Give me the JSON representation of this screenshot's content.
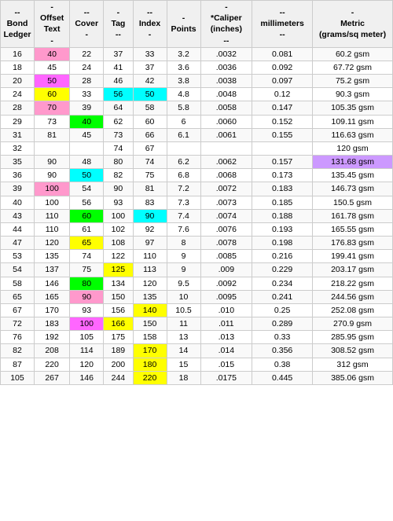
{
  "headers": [
    {
      "label": "--\nBond\nLedger",
      "sub": ""
    },
    {
      "label": "-\nOffset\nText",
      "sub": "-"
    },
    {
      "label": "--\nCover",
      "sub": "-"
    },
    {
      "label": "-\nTag",
      "sub": "--"
    },
    {
      "label": "--\nIndex",
      "sub": "-"
    },
    {
      "label": "-\nPoints",
      "sub": ""
    },
    {
      "label": "-\n*Caliper\n(inches)",
      "sub": "--"
    },
    {
      "label": "--\nmillimeters",
      "sub": "--"
    },
    {
      "label": "-\nMetric\n(grams/sq meter)",
      "sub": ""
    }
  ],
  "rows": [
    {
      "bond": 16,
      "offset": "40",
      "cover": 22,
      "tag": 37,
      "index": 33,
      "points": 3.2,
      "caliper": ".0032",
      "mm": "0.081",
      "metric": "60.2 gsm",
      "colors": {
        "offset": "pink"
      }
    },
    {
      "bond": 18,
      "offset": "45",
      "cover": 24,
      "tag": 41,
      "index": 37,
      "points": 3.6,
      "caliper": ".0036",
      "mm": "0.092",
      "metric": "67.72 gsm",
      "colors": {}
    },
    {
      "bond": 20,
      "offset": "50",
      "cover": 28,
      "tag": 46,
      "index": 42,
      "points": 3.8,
      "caliper": ".0038",
      "mm": "0.097",
      "metric": "75.2 gsm",
      "colors": {
        "offset": "magenta"
      }
    },
    {
      "bond": 24,
      "offset": "60",
      "cover": 33,
      "tag": 56,
      "index": 50,
      "points": 4.8,
      "caliper": ".0048",
      "mm": "0.12",
      "metric": "90.3 gsm",
      "colors": {
        "offset": "yellow",
        "tag": "cyan",
        "index": "cyan"
      }
    },
    {
      "bond": 28,
      "offset": "70",
      "cover": 39,
      "tag": 64,
      "index": 58,
      "points": 5.8,
      "caliper": ".0058",
      "mm": "0.147",
      "metric": "105.35 gsm",
      "colors": {
        "offset": "pink"
      }
    },
    {
      "bond": 29,
      "offset": "73",
      "cover": "40",
      "tag": 62,
      "index": 60,
      "points": 6,
      "caliper": ".0060",
      "mm": "0.152",
      "metric": "109.11 gsm",
      "colors": {
        "cover": "green"
      }
    },
    {
      "bond": 31,
      "offset": "81",
      "cover": 45,
      "tag": 73,
      "index": 66,
      "points": 6.1,
      "caliper": ".0061",
      "mm": "0.155",
      "metric": "116.63 gsm",
      "colors": {}
    },
    {
      "bond": 32,
      "offset": "",
      "cover": "",
      "tag": 74,
      "index": 67,
      "points": "",
      "caliper": "",
      "mm": "",
      "metric": "120 gsm",
      "colors": {}
    },
    {
      "bond": 35,
      "offset": "90",
      "cover": 48,
      "tag": 80,
      "index": 74,
      "points": 6.2,
      "caliper": ".0062",
      "mm": "0.157",
      "metric": "131.68 gsm",
      "colors": {
        "metric": "lavender"
      }
    },
    {
      "bond": 36,
      "offset": "90",
      "cover": "50",
      "tag": 82,
      "index": 75,
      "points": 6.8,
      "caliper": ".0068",
      "mm": "0.173",
      "metric": "135.45 gsm",
      "colors": {
        "cover": "cyan"
      }
    },
    {
      "bond": 39,
      "offset": "100",
      "cover": 54,
      "tag": 90,
      "index": 81,
      "points": 7.2,
      "caliper": ".0072",
      "mm": "0.183",
      "metric": "146.73 gsm",
      "colors": {
        "offset": "pink"
      }
    },
    {
      "bond": 40,
      "offset": "100",
      "cover": 56,
      "tag": 93,
      "index": 83,
      "points": 7.3,
      "caliper": ".0073",
      "mm": "0.185",
      "metric": "150.5 gsm",
      "colors": {}
    },
    {
      "bond": 43,
      "offset": "110",
      "cover": "60",
      "tag": 100,
      "index": "90",
      "points": 7.4,
      "caliper": ".0074",
      "mm": "0.188",
      "metric": "161.78 gsm",
      "colors": {
        "cover": "green",
        "index": "cyan"
      }
    },
    {
      "bond": 44,
      "offset": "110",
      "cover": 61,
      "tag": 102,
      "index": 92,
      "points": 7.6,
      "caliper": ".0076",
      "mm": "0.193",
      "metric": "165.55 gsm",
      "colors": {}
    },
    {
      "bond": 47,
      "offset": "120",
      "cover": "65",
      "tag": 108,
      "index": 97,
      "points": 8,
      "caliper": ".0078",
      "mm": "0.198",
      "metric": "176.83 gsm",
      "colors": {
        "cover": "yellow"
      }
    },
    {
      "bond": 53,
      "offset": "135",
      "cover": 74,
      "tag": 122,
      "index": 110,
      "points": 9,
      "caliper": ".0085",
      "mm": "0.216",
      "metric": "199.41 gsm",
      "colors": {}
    },
    {
      "bond": 54,
      "offset": "137",
      "cover": 75,
      "tag": "125",
      "index": 113,
      "points": 9,
      "caliper": ".009",
      "mm": "0.229",
      "metric": "203.17 gsm",
      "colors": {
        "tag": "yellow"
      }
    },
    {
      "bond": 58,
      "offset": "146",
      "cover": "80",
      "tag": 134,
      "index": 120,
      "points": 9.5,
      "caliper": ".0092",
      "mm": "0.234",
      "metric": "218.22 gsm",
      "colors": {
        "cover": "green"
      }
    },
    {
      "bond": 65,
      "offset": "165",
      "cover": "90",
      "tag": 150,
      "index": 135,
      "points": 10,
      "caliper": ".0095",
      "mm": "0.241",
      "metric": "244.56 gsm",
      "colors": {
        "cover": "pink"
      }
    },
    {
      "bond": 67,
      "offset": "170",
      "cover": 93,
      "tag": 156,
      "index": "140",
      "points": 10.5,
      "caliper": ".010",
      "mm": "0.25",
      "metric": "252.08 gsm",
      "colors": {
        "index": "yellow"
      }
    },
    {
      "bond": 72,
      "offset": "183",
      "cover": "100",
      "tag": 166,
      "index": 150,
      "points": 11,
      "caliper": ".011",
      "mm": "0.289",
      "metric": "270.9 gsm",
      "colors": {
        "cover": "magenta",
        "tag": "yellow"
      }
    },
    {
      "bond": 76,
      "offset": "192",
      "cover": 105,
      "tag": 175,
      "index": 158,
      "points": 13,
      "caliper": ".013",
      "mm": "0.33",
      "metric": "285.95 gsm",
      "colors": {}
    },
    {
      "bond": 82,
      "offset": "208",
      "cover": 114,
      "tag": 189,
      "index": "170",
      "points": 14,
      "caliper": ".014",
      "mm": "0.356",
      "metric": "308.52 gsm",
      "colors": {
        "index": "yellow"
      }
    },
    {
      "bond": 87,
      "offset": "220",
      "cover": 120,
      "tag": 200,
      "index": "180",
      "points": 15,
      "caliper": ".015",
      "mm": "0.38",
      "metric": "312 gsm",
      "colors": {
        "index": "yellow"
      }
    },
    {
      "bond": 105,
      "offset": "267",
      "cover": 146,
      "tag": 244,
      "index": "220",
      "points": 18,
      "caliper": ".0175",
      "mm": "0.445",
      "metric": "385.06 gsm",
      "colors": {
        "index": "yellow"
      }
    }
  ]
}
